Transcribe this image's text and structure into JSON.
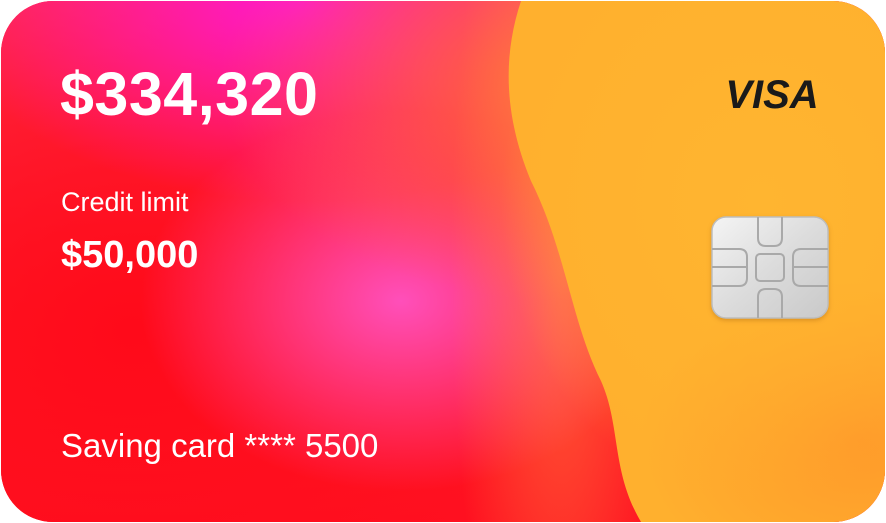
{
  "card": {
    "balance": "$334,320",
    "credit_limit_label": "Credit limit",
    "credit_limit_value": "$50,000",
    "card_name": "Saving card **** 5500",
    "brand": "VISA",
    "chip_icon": "emv-chip-icon"
  },
  "colors": {
    "red": "#ff1a25",
    "magenta": "#ff18d0",
    "pink": "#ff4fba",
    "yellow": "#ffb02e",
    "brand_text": "#1a1a1a",
    "text": "#ffffff"
  }
}
